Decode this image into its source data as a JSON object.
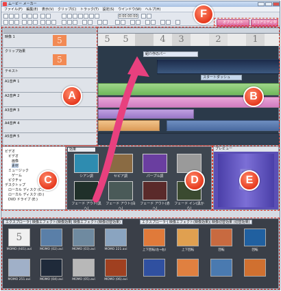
{
  "window": {
    "title": "ムービー メーカー"
  },
  "menu": [
    "ファイル(F)",
    "編集(E)",
    "表示(V)",
    "クリップ(C)",
    "トラック(T)",
    "設定(S)",
    "ウインドウ(W)",
    "ヘルプ(H)"
  ],
  "toolbar": {
    "timecode": "0:00:00:00",
    "pink_button_1": "オブジェクト",
    "pink_button_2": "スコアエディタ"
  },
  "tracks": [
    {
      "label": "映像 1",
      "value": "5"
    },
    {
      "label": "クリップ効果",
      "value": "5"
    },
    {
      "label": "テキスト",
      "value": ""
    },
    {
      "label": "A1音声 1",
      "value": ""
    },
    {
      "label": "A2音声 2",
      "value": ""
    },
    {
      "label": "A3音声 3",
      "value": ""
    },
    {
      "label": "A4音声 4",
      "value": ""
    },
    {
      "label": "A5音声 5",
      "value": ""
    }
  ],
  "timeline": {
    "frames": [
      "5",
      "5",
      "4",
      "3",
      "2",
      "1"
    ],
    "title_clip": "紹介作のパー",
    "video_clip_label": "スタートダッシュ"
  },
  "folders": [
    "ビデオ",
    "ビデオ",
    "画像",
    "素材",
    "ミュージック",
    "ゲーム",
    "ピクチャ",
    "デスクトップ",
    "ローカル ディスク (C:)",
    "ローカル ディスク (D:)",
    "DVD ドライブ (E:)"
  ],
  "effects": {
    "tab": "効果",
    "items": [
      {
        "label": "シアン調",
        "color": "#2e8cb0"
      },
      {
        "label": "セピア調",
        "color": "#8a6b43"
      },
      {
        "label": "パープル調",
        "color": "#6a3ea0"
      },
      {
        "label": "白黒",
        "color": "#9a9a9a"
      },
      {
        "label": "フェード アウト(黒へ)",
        "color": "#20302a"
      },
      {
        "label": "フェード アウト(白へ)",
        "color": "#4a5a58"
      },
      {
        "label": "フェード アウト(赤へ)",
        "color": "#5a2a2a"
      },
      {
        "label": "フェード イン(黒から)",
        "color": "#3a4a30"
      }
    ]
  },
  "preview": {
    "title": "プレビュー",
    "frame": "5"
  },
  "bottom": {
    "tabs_left": [
      "エクスプローラー",
      "映像エフェクト(映像効果)",
      "映像エフェクト(映像切替効果)"
    ],
    "tabs_right": [
      "エクスプローラー",
      "映像エフェクト(映像効果)",
      "映像切替効果 (切替効果)"
    ],
    "left_items": [
      {
        "label": "MOMO (h01).avi",
        "color": "#f0f0f0"
      },
      {
        "label": "MOMO (02).avi",
        "color": "#5a7fa8"
      },
      {
        "label": "MOMO (03).avi",
        "color": "#6f8aa0"
      },
      {
        "label": "MOMO 221.avi",
        "color": "#8aa4c0"
      },
      {
        "label": "MOMO 251.avi",
        "color": "#a0b0c8"
      },
      {
        "label": "MOMO (04).avi",
        "color": "#1f2a3a"
      },
      {
        "label": "MOMO (05).avi",
        "color": "#b8b8b8"
      },
      {
        "label": "MOMO (06).avi",
        "color": "#a04020"
      }
    ],
    "right_items": [
      {
        "label": "上下回転(左→右)",
        "color": "#e07a3a"
      },
      {
        "label": "上下回転",
        "color": "#e0a050"
      },
      {
        "label": "回転",
        "color": "#c86a40"
      },
      {
        "label": "回転",
        "color": "#2060a0"
      },
      {
        "label": "",
        "color": "#3050a0"
      },
      {
        "label": "",
        "color": "#e08040"
      },
      {
        "label": "",
        "color": "#4a7ab0"
      },
      {
        "label": "",
        "color": "#d07030"
      }
    ]
  },
  "callouts": [
    "A",
    "B",
    "C",
    "D",
    "E",
    "F"
  ]
}
